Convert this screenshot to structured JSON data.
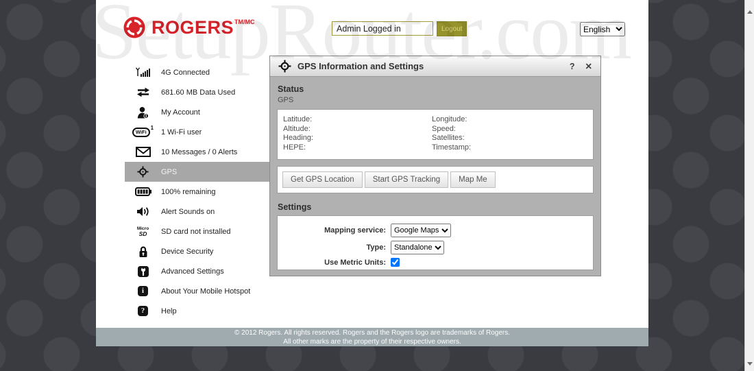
{
  "header": {
    "brand": "ROGERS",
    "brand_superscript": "TM/MC",
    "login_status": "Admin Logged in",
    "logout_label": "Logout",
    "language_selected": "English"
  },
  "sidebar": {
    "items": [
      {
        "icon": "signal-icon",
        "label": "4G Connected"
      },
      {
        "icon": "data-usage-icon",
        "label": "681.60 MB Data Used"
      },
      {
        "icon": "account-icon",
        "label": "My Account"
      },
      {
        "icon": "wifi-icon",
        "label": "1 Wi-Fi user"
      },
      {
        "icon": "messages-icon",
        "label": "10 Messages / 0 Alerts"
      },
      {
        "icon": "gps-icon",
        "label": "GPS",
        "selected": true
      },
      {
        "icon": "battery-icon",
        "label": "100% remaining"
      },
      {
        "icon": "speaker-icon",
        "label": "Alert Sounds on"
      },
      {
        "icon": "microsd-icon",
        "label": "SD card not installed"
      },
      {
        "icon": "lock-icon",
        "label": "Device Security"
      },
      {
        "icon": "wrench-icon",
        "label": "Advanced Settings"
      },
      {
        "icon": "info-icon",
        "label": "About Your Mobile Hotspot"
      },
      {
        "icon": "help-icon",
        "label": "Help"
      }
    ],
    "wifi_badge": {
      "text": "WiFi",
      "count": "1"
    },
    "microsd_badge": {
      "line1": "Micro",
      "line2": "SD"
    },
    "info_badge": "i",
    "help_badge": "?"
  },
  "panel": {
    "title": "GPS Information and Settings",
    "help_button": "?",
    "close_button": "✕",
    "status_heading": "Status",
    "status_subheading": "GPS",
    "fields_left": [
      {
        "label": "Latitude:",
        "value": ""
      },
      {
        "label": "Altitude:",
        "value": ""
      },
      {
        "label": "Heading:",
        "value": ""
      },
      {
        "label": "HEPE:",
        "value": ""
      }
    ],
    "fields_right": [
      {
        "label": "Longitude:",
        "value": ""
      },
      {
        "label": "Speed:",
        "value": ""
      },
      {
        "label": "Satellites:",
        "value": ""
      },
      {
        "label": "Timestamp:",
        "value": ""
      }
    ],
    "buttons": [
      "Get GPS Location",
      "Start GPS Tracking",
      "Map Me"
    ],
    "settings_heading": "Settings",
    "settings": {
      "mapping_service_label": "Mapping service:",
      "mapping_service_value": "Google Maps",
      "type_label": "Type:",
      "type_value": "Standalone",
      "metric_units_label": "Use Metric Units:",
      "metric_units_checked": true
    }
  },
  "footer": {
    "line1": "© 2012 Rogers. All rights reserved. Rogers and the Rogers logo are trademarks of Rogers.",
    "line2": "All other marks are the property of their respective owners."
  },
  "watermark": "SetupRouter.com",
  "colors": {
    "brand_red": "#d8232a",
    "logout_olive": "#97932c",
    "panel_body_gray": "#b1b1b1",
    "selected_item_gray": "#a7a7a7",
    "footer_gray": "#9fabaf",
    "background_dark": "#3a3b41"
  }
}
